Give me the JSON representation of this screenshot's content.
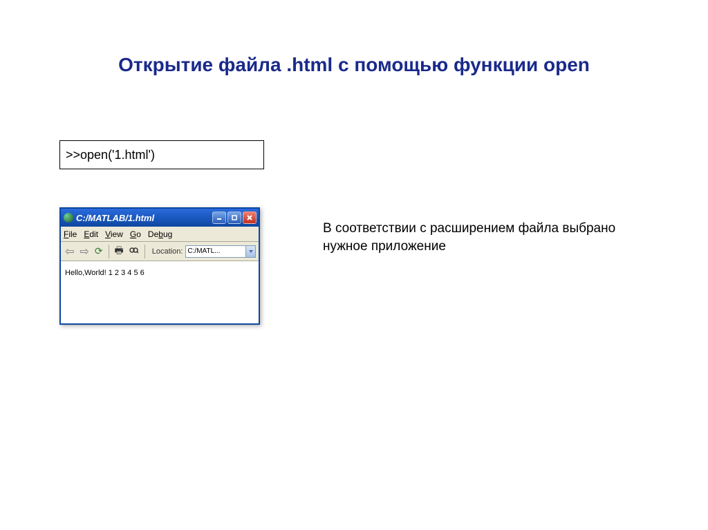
{
  "title": "Открытие файла .html с помощью функции open",
  "code_box": ">>open('1.html')",
  "browser": {
    "titlebar_text": "C:/MATLAB/1.html",
    "menus": {
      "file": "File",
      "edit": "Edit",
      "view": "View",
      "go": "Go",
      "debug": "Debug"
    },
    "toolbar": {
      "location_label": "Location:",
      "location_value": "C:/MATL..."
    },
    "content": "Hello,World! 1 2 3 4 5 6"
  },
  "explanation": "В соответствии с расширением файла выбрано нужное приложение"
}
